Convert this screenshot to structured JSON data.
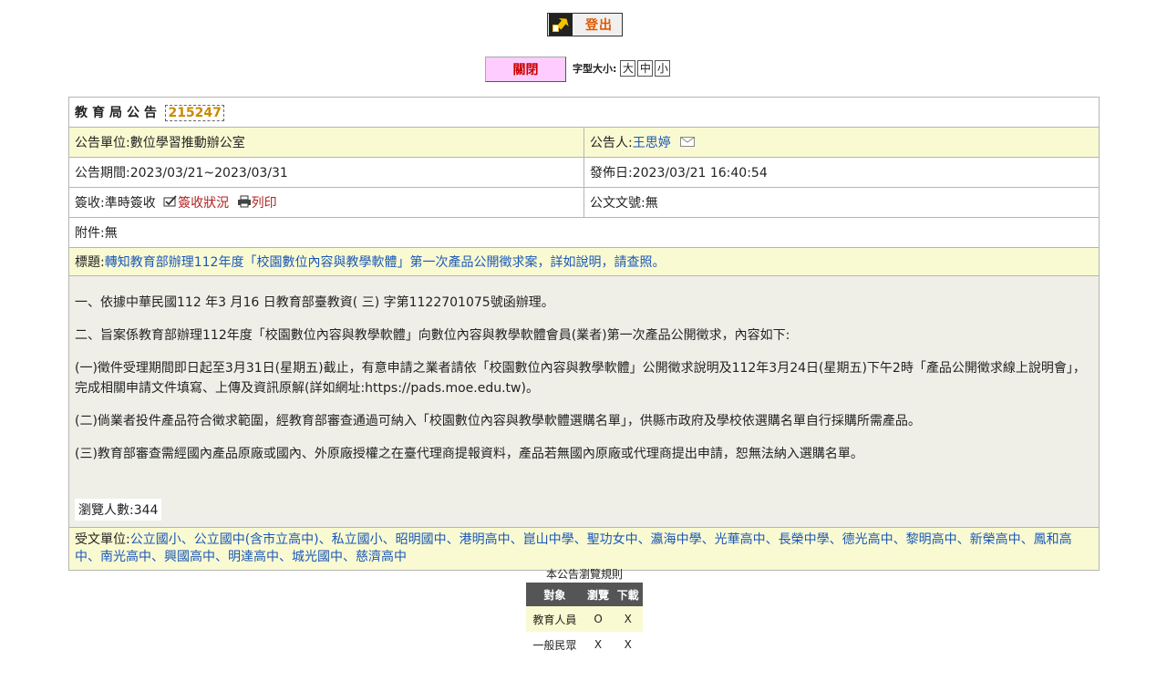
{
  "header": {
    "logout_label": "登出",
    "close_label": "關閉",
    "font_size_label": "字型大小:",
    "font_sizes": [
      "大",
      "中",
      "小"
    ]
  },
  "notice": {
    "caption": "教育局公告",
    "id": "215247",
    "unit_label": "公告單位:",
    "unit": "數位學習推動辦公室",
    "publisher_label": "公告人:",
    "publisher": "王思婷",
    "period_label": "公告期間:",
    "period": "2023/03/21~2023/03/31",
    "publish_date_label": "發佈日:",
    "publish_date": "2023/03/21 16:40:54",
    "receipt_label": "簽收:",
    "receipt": "準時簽收",
    "receipt_status": "簽收狀況",
    "print_label": "列印",
    "doc_no_label": "公文文號:",
    "doc_no": "無",
    "attachment_label": "附件:",
    "attachment": "無",
    "subject_label": "標題:",
    "subject": "轉知教育部辦理112年度「校園數位內容與教學軟體」第一次產品公開徵求案，詳如說明，請查照。",
    "body": [
      "一、依據中華民國112 年3 月16 日教育部臺教資( 三) 字第1122701075號函辦理。",
      "二、旨案係教育部辦理112年度「校園數位內容與教學軟體」向數位內容與教學軟體會員(業者)第一次產品公開徵求，內容如下:",
      "(一)徵件受理期間即日起至3月31日(星期五)截止，有意申請之業者請依「校園數位內容與教學軟體」公開徵求說明及112年3月24日(星期五)下午2時「產品公開徵求線上說明會」，完成相關申請文件填寫、上傳及資訊原解(詳如網址:https://pads.moe.edu.tw)。",
      "(二)倘業者投件產品符合徵求範圍，經教育部審查通過可納入「校園數位內容與教學軟體選購名單」，供縣市政府及學校依選購名單自行採購所需產品。",
      "(三)教育部審查需經國內產品原廠或國內、外原廠授權之在臺代理商提報資料，產品若無國內原廠或代理商提出申請，恕無法納入選購名單。"
    ],
    "view_count_label": "瀏覽人數:",
    "view_count": "344",
    "recipients_label": "受文單位:",
    "recipients": "公立國小、公立國中(含市立高中)、私立國小、昭明國中、港明高中、崑山中學、聖功女中、瀛海中學、光華高中、長榮中學、德光高中、黎明高中、新榮高中、鳳和高中、南光高中、興國高中、明達高中、城光國中、慈濟高中"
  },
  "rules": {
    "caption": "本公告瀏覽規則",
    "headers": [
      "對象",
      "瀏覽",
      "下載"
    ],
    "rows": [
      [
        "教育人員",
        "O",
        "X"
      ],
      [
        "一般民眾",
        "X",
        "X"
      ]
    ]
  }
}
